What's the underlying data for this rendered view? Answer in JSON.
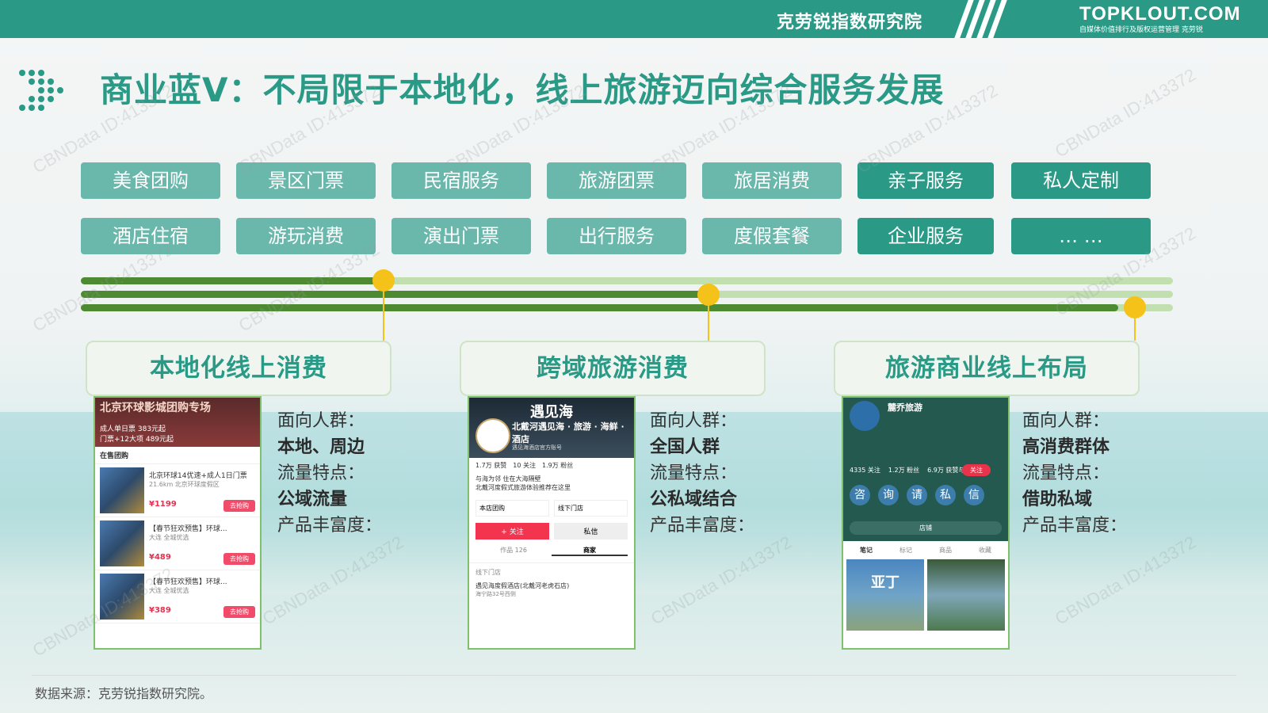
{
  "header": {
    "institute": "克劳锐指数研究院",
    "logo_main": "TOPKLOUT.COM",
    "logo_sub": "自媒体价值排行及版权运营管理 克劳锐"
  },
  "title": "商业蓝V：不局限于本地化，线上旅游迈向综合服务发展",
  "tags_row1": [
    "美食团购",
    "景区门票",
    "民宿服务",
    "旅游团票",
    "旅居消费",
    "亲子服务",
    "私人定制"
  ],
  "tags_row2": [
    "酒店住宿",
    "游玩消费",
    "演出门票",
    "出行服务",
    "度假套餐",
    "企业服务",
    "… …"
  ],
  "progress": {
    "track1_fill": 0.27,
    "track2_fill": 0.57,
    "track3_fill": 0.95
  },
  "stages": [
    {
      "title": "本地化线上消费",
      "labels": [
        "面向人群：",
        "本地、周边",
        "流量特点：",
        "公域流量",
        "产品丰富度："
      ],
      "phone": {
        "banner": "北京环球影城团购专场",
        "banner_sub1": "成人单日票 383元起",
        "banner_sub2": "门票+12大项 489元起",
        "section": "在售团购",
        "items": [
          {
            "name": "北京环球14优速+成人1日门票",
            "meta": "21.6km 北京环球度假区",
            "price": "¥1199",
            "btn": "去抢购"
          },
          {
            "name": "【春节狂欢预售】环球...",
            "meta": "大连 全城优选",
            "price": "¥489",
            "btn": "去抢购"
          },
          {
            "name": "【春节狂欢预售】环球...",
            "meta": "大连 全城优选",
            "price": "¥389",
            "btn": "去抢购"
          }
        ]
      }
    },
    {
      "title": "跨域旅游消费",
      "labels": [
        "面向人群：",
        "全国人群",
        "流量特点：",
        "公私域结合",
        "产品丰富度："
      ],
      "phone": {
        "banner": "遇见海",
        "name": "北戴河遇见海 · 旅游 · 海鲜 · 酒店",
        "tagline": "遇见海酒店官方账号",
        "stats": [
          "1.7万 获赞",
          "10 关注",
          "1.9万 粉丝"
        ],
        "bio": "与海为邻 住在大海隔壁",
        "bio2": "北戴河度假式旅游体验推荐在这里",
        "shop1": "本店团购",
        "shop2": "线下门店",
        "follow": "+ 关注",
        "msg": "私信",
        "tab1": "作品 126",
        "tab2": "商家",
        "store_label": "线下门店",
        "store": "遇见海度假酒店(北戴河老虎石店)",
        "store_addr": "海宁路32号西侧"
      }
    },
    {
      "title": "旅游商业线上布局",
      "labels": [
        "面向人群：",
        "高消费群体",
        "流量特点：",
        "借助私域",
        "产品丰富度："
      ],
      "phone": {
        "name": "麓乔旅游",
        "stats": [
          "4335 关注",
          "1.2万 粉丝",
          "6.9万 获赞与收藏"
        ],
        "follow": "关注",
        "icons": [
          "咨",
          "询",
          "请",
          "私",
          "信"
        ],
        "shop": "店铺",
        "tabs": [
          "笔记",
          "标记",
          "商品",
          "收藏"
        ],
        "img_text": "亚丁"
      }
    }
  ],
  "footer": "数据来源：克劳锐指数研究院。",
  "watermark": "CBNData ID:413372",
  "colors": {
    "brand": "#2a9a87",
    "tag_light": "#6ab7ac",
    "track_fill": "#4e8a32",
    "track_bg": "#c2dfaf",
    "marker": "#f5c21a"
  }
}
